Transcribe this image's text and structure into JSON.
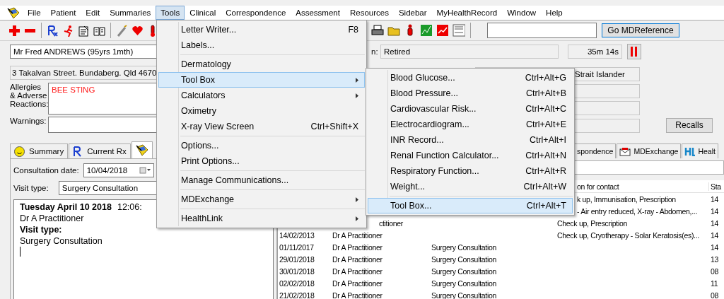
{
  "menu_bar": [
    {
      "label": "File",
      "selected": false
    },
    {
      "label": "Patient",
      "selected": false
    },
    {
      "label": "Edit",
      "selected": false
    },
    {
      "label": "Summaries",
      "selected": false
    },
    {
      "label": "Tools",
      "selected": true
    },
    {
      "label": "Clinical",
      "selected": false
    },
    {
      "label": "Correspondence",
      "selected": false
    },
    {
      "label": "Assessment",
      "selected": false
    },
    {
      "label": "Resources",
      "selected": false
    },
    {
      "label": "Sidebar",
      "selected": false
    },
    {
      "label": "MyHealthRecord",
      "selected": false
    },
    {
      "label": "Window",
      "selected": false
    },
    {
      "label": "Help",
      "selected": false
    }
  ],
  "toolbar": {
    "go_button": "Go MDReference"
  },
  "patient": {
    "name": "Mr Fred ANDREWS (95yrs 1mth)",
    "address": "3 Takalvan Street. Bundaberg. Qld  4670",
    "allergies_label": "Allergies & Adverse Reactions:",
    "allergies": "BEE STING",
    "warnings_label": "Warnings:"
  },
  "details": {
    "occupation_label": "n:",
    "occupation": "Retired",
    "timer": "35m 14s",
    "atsi": "Strait Islander",
    "recalls_button": "Recalls"
  },
  "left_tabs": [
    {
      "kind": "smiley",
      "label": "Summary",
      "selected": false
    },
    {
      "kind": "rx",
      "label": "Current Rx",
      "selected": false
    },
    {
      "kind": "logo",
      "selected": true
    }
  ],
  "consultation": {
    "date_label": "Consultation date:",
    "date": "10/04/2018",
    "visit_type_label": "Visit type:",
    "visit_type": "Surgery Consultation",
    "notes": [
      {
        "kind": "heading",
        "text": "Tuesday April 10 2018",
        "time": "12:06:"
      },
      {
        "kind": "text",
        "text": "Dr A Practitioner"
      },
      {
        "kind": "label",
        "text": "Visit type:"
      },
      {
        "kind": "text",
        "text": "Surgery Consultation"
      }
    ]
  },
  "right_tabs": [
    {
      "kind": "plain",
      "label": "spondence"
    },
    {
      "kind": "mdexchange",
      "label": "MDExchange"
    },
    {
      "kind": "healthlink",
      "label": "Healt"
    }
  ],
  "history_table": {
    "columns": [
      "on for contact",
      "Sta"
    ],
    "rows": [
      {
        "reason": "k up, Immunisation, Prescription",
        "status": "14"
      },
      {
        "reason": "- Air entry reduced, X-ray - Abdomen,...",
        "status": "14"
      },
      {
        "author": "ctitioner",
        "reason": "Check up, Prescription",
        "status": "14"
      },
      {
        "date": "14/02/2013",
        "author": "Dr A Practitioner",
        "reason": "Check up, Cryotherapy - Solar Keratosis(es)...",
        "status": "14"
      },
      {
        "date": "01/11/2017",
        "author": "Dr A Practitioner",
        "visit_type": "Surgery Consultation",
        "status": "14"
      },
      {
        "date": "29/01/2018",
        "author": "Dr A Practitioner",
        "visit_type": "Surgery Consultation",
        "status": "13"
      },
      {
        "date": "30/01/2018",
        "author": "Dr A Practitioner",
        "visit_type": "Surgery Consultation",
        "status": "08"
      },
      {
        "date": "02/02/2018",
        "author": "Dr A Practitioner",
        "visit_type": "Surgery Consultation",
        "status": "11"
      },
      {
        "date": "21/02/2018",
        "author": "Dr A Practitioner",
        "visit_type": "Surgery Consultation",
        "status": "08"
      }
    ]
  },
  "tools_menu": {
    "items": [
      {
        "kind": "item",
        "label": "Letter Writer...",
        "shortcut": "F8",
        "submenu": false,
        "selected": false
      },
      {
        "kind": "item",
        "label": "Labels...",
        "submenu": false,
        "selected": false
      },
      {
        "kind": "separator"
      },
      {
        "kind": "item",
        "label": "Dermatology",
        "submenu": false,
        "selected": false
      },
      {
        "kind": "item",
        "label": "Tool Box",
        "submenu": true,
        "selected": true
      },
      {
        "kind": "item",
        "label": "Calculators",
        "submenu": true,
        "selected": false
      },
      {
        "kind": "item",
        "label": "Oximetry",
        "submenu": false,
        "selected": false
      },
      {
        "kind": "item",
        "label": "X-ray View Screen",
        "shortcut": "Ctrl+Shift+X",
        "submenu": false,
        "selected": false
      },
      {
        "kind": "separator"
      },
      {
        "kind": "item",
        "label": "Options...",
        "submenu": false,
        "selected": false
      },
      {
        "kind": "item",
        "label": "Print Options...",
        "submenu": false,
        "selected": false
      },
      {
        "kind": "separator"
      },
      {
        "kind": "item",
        "label": "Manage Communications...",
        "submenu": false,
        "selected": false
      },
      {
        "kind": "separator"
      },
      {
        "kind": "item",
        "label": "MDExchange",
        "submenu": true,
        "selected": false
      },
      {
        "kind": "separator"
      },
      {
        "kind": "item",
        "label": "HealthLink",
        "submenu": true,
        "selected": false
      }
    ]
  },
  "toolbox_submenu": {
    "items": [
      {
        "kind": "item",
        "label": "Blood Glucose...",
        "shortcut": "Ctrl+Alt+G",
        "selected": false
      },
      {
        "kind": "item",
        "label": "Blood Pressure...",
        "shortcut": "Ctrl+Alt+B",
        "selected": false
      },
      {
        "kind": "item",
        "label": "Cardiovascular Risk...",
        "shortcut": "Ctrl+Alt+C",
        "selected": false
      },
      {
        "kind": "item",
        "label": "Electrocardiogram...",
        "shortcut": "Ctrl+Alt+E",
        "selected": false
      },
      {
        "kind": "item",
        "label": "INR Record...",
        "shortcut": "Ctrl+Alt+I",
        "selected": false
      },
      {
        "kind": "item",
        "label": "Renal Function Calculator...",
        "shortcut": "Ctrl+Alt+N",
        "selected": false
      },
      {
        "kind": "item",
        "label": "Respiratory Function...",
        "shortcut": "Ctrl+Alt+R",
        "selected": false
      },
      {
        "kind": "item",
        "label": "Weight...",
        "shortcut": "Ctrl+Alt+W",
        "selected": false
      },
      {
        "kind": "separator"
      },
      {
        "kind": "item",
        "label": "Tool Box...",
        "shortcut": "Ctrl+Alt+T",
        "selected": true
      }
    ]
  }
}
